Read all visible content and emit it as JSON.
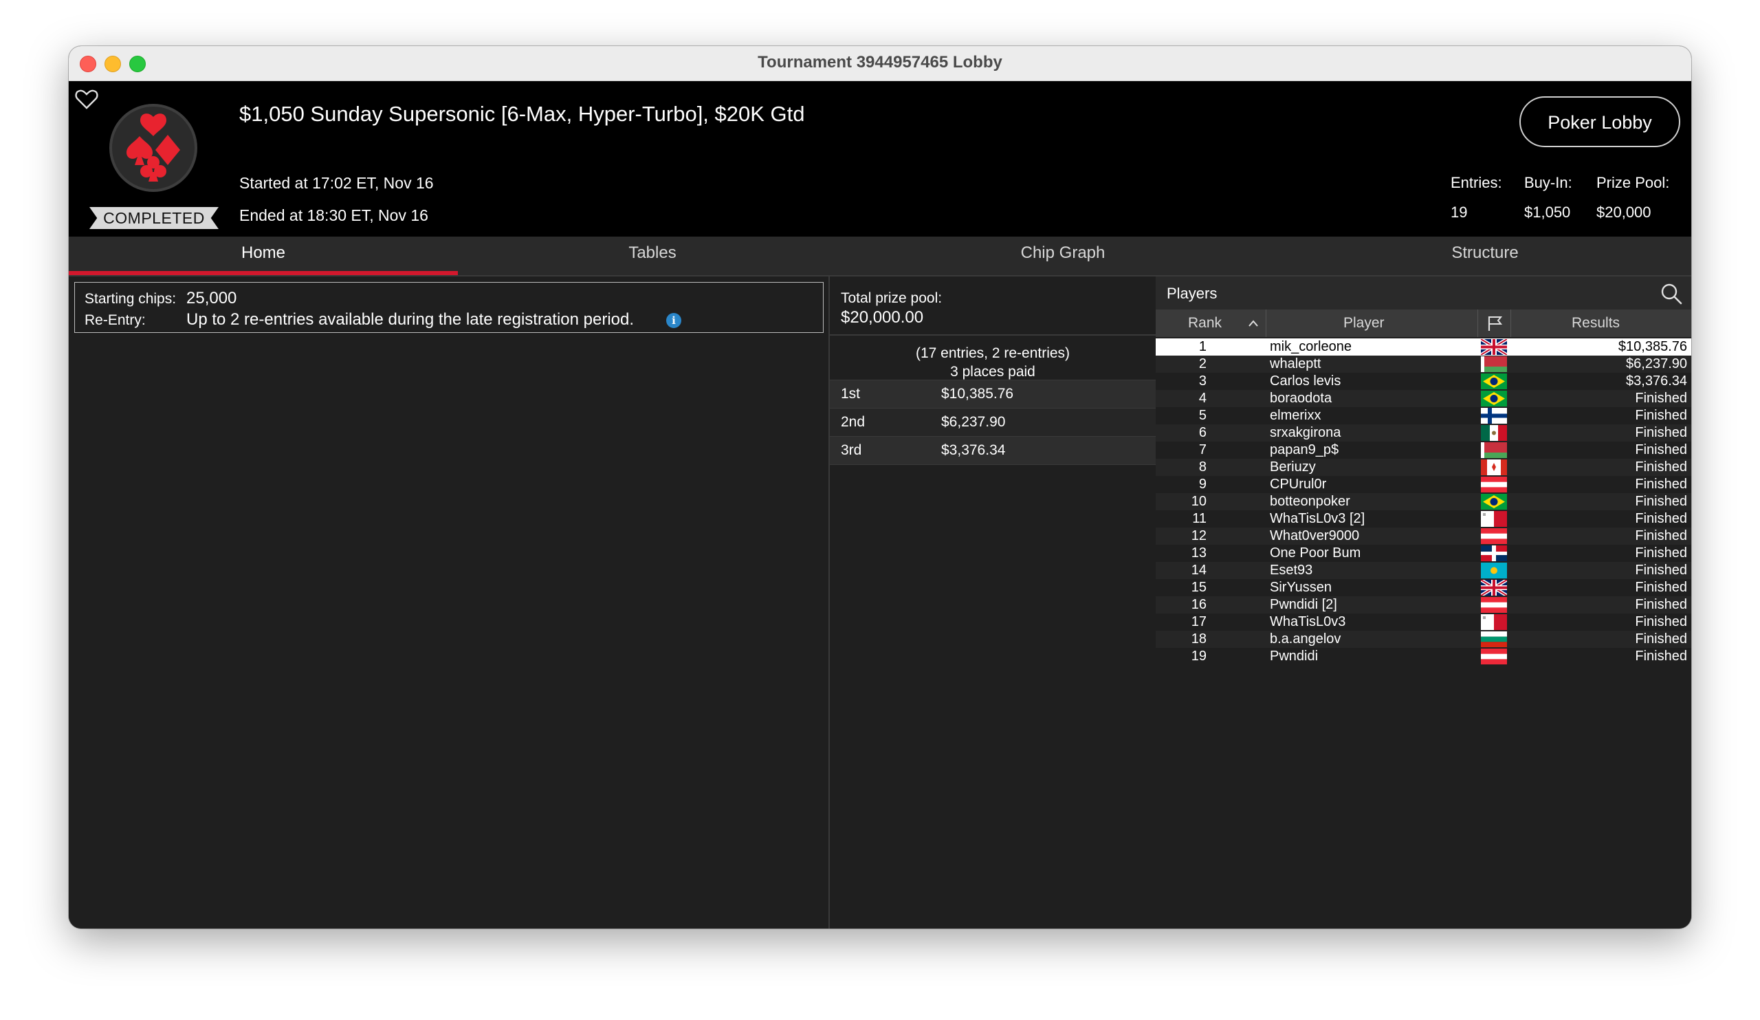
{
  "window": {
    "title": "Tournament 3944957465 Lobby"
  },
  "header": {
    "status_badge": "COMPLETED",
    "tournament_name": "$1,050 Sunday Supersonic [6-Max, Hyper-Turbo], $20K Gtd",
    "started": "Started at 17:02 ET, Nov 16",
    "ended": "Ended at 18:30 ET, Nov 16",
    "poker_lobby_label": "Poker Lobby",
    "stats": {
      "entries_label": "Entries:",
      "entries_value": "19",
      "buyin_label": "Buy-In:",
      "buyin_value": "$1,050",
      "prizepool_label": "Prize Pool:",
      "prizepool_value": "$20,000"
    },
    "icons": {
      "favorite": "heart-icon",
      "logo": "card-suits-logo-icon"
    }
  },
  "tabs": [
    {
      "label": "Home",
      "active": true
    },
    {
      "label": "Tables",
      "active": false
    },
    {
      "label": "Chip Graph",
      "active": false
    },
    {
      "label": "Structure",
      "active": false
    }
  ],
  "home": {
    "starting_chips_label": "Starting chips:",
    "starting_chips_value": "25,000",
    "reentry_label": "Re-Entry:",
    "reentry_value": "Up to 2 re-entries available during the late registration period.",
    "info_icon": "i"
  },
  "prize": {
    "total_label": "Total prize pool:",
    "total_value": "$20,000.00",
    "entries_text": "(17 entries, 2 re-entries)",
    "paid_text": "3 places paid",
    "places": [
      {
        "place": "1st",
        "amount": "$10,385.76"
      },
      {
        "place": "2nd",
        "amount": "$6,237.90"
      },
      {
        "place": "3rd",
        "amount": "$3,376.34"
      }
    ]
  },
  "players": {
    "title": "Players",
    "columns": {
      "rank": "Rank",
      "player": "Player",
      "results": "Results"
    },
    "colors": {
      "accent_red": "#d3182d",
      "selected_row": "#ffffff"
    },
    "rows": [
      {
        "rank": "1",
        "name": "mik_corleone",
        "flag": "uk",
        "result": "$10,385.76"
      },
      {
        "rank": "2",
        "name": "whaleptt",
        "flag": "belarus",
        "result": "$6,237.90"
      },
      {
        "rank": "3",
        "name": "Carlos levis",
        "flag": "brazil",
        "result": "$3,376.34"
      },
      {
        "rank": "4",
        "name": "boraodota",
        "flag": "brazil",
        "result": "Finished"
      },
      {
        "rank": "5",
        "name": "elmerixx",
        "flag": "finland",
        "result": "Finished"
      },
      {
        "rank": "6",
        "name": "srxakgirona",
        "flag": "mexico",
        "result": "Finished"
      },
      {
        "rank": "7",
        "name": "papan9_p$",
        "flag": "belarus",
        "result": "Finished"
      },
      {
        "rank": "8",
        "name": "Beriuzy",
        "flag": "canada",
        "result": "Finished"
      },
      {
        "rank": "9",
        "name": "CPUrul0r",
        "flag": "austria",
        "result": "Finished"
      },
      {
        "rank": "10",
        "name": "botteonpoker",
        "flag": "brazil",
        "result": "Finished"
      },
      {
        "rank": "11",
        "name": "WhaTisL0v3 [2]",
        "flag": "malta",
        "result": "Finished"
      },
      {
        "rank": "12",
        "name": "What0ver9000",
        "flag": "austria",
        "result": "Finished"
      },
      {
        "rank": "13",
        "name": "One Poor Bum",
        "flag": "dominican",
        "result": "Finished"
      },
      {
        "rank": "14",
        "name": "Eset93",
        "flag": "kazakhstan",
        "result": "Finished"
      },
      {
        "rank": "15",
        "name": "SirYussen",
        "flag": "uk",
        "result": "Finished"
      },
      {
        "rank": "16",
        "name": "Pwndidi [2]",
        "flag": "austria",
        "result": "Finished"
      },
      {
        "rank": "17",
        "name": "WhaTisL0v3",
        "flag": "malta",
        "result": "Finished"
      },
      {
        "rank": "18",
        "name": "b.a.angelov",
        "flag": "bulgaria",
        "result": "Finished"
      },
      {
        "rank": "19",
        "name": "Pwndidi",
        "flag": "austria",
        "result": "Finished"
      }
    ]
  }
}
